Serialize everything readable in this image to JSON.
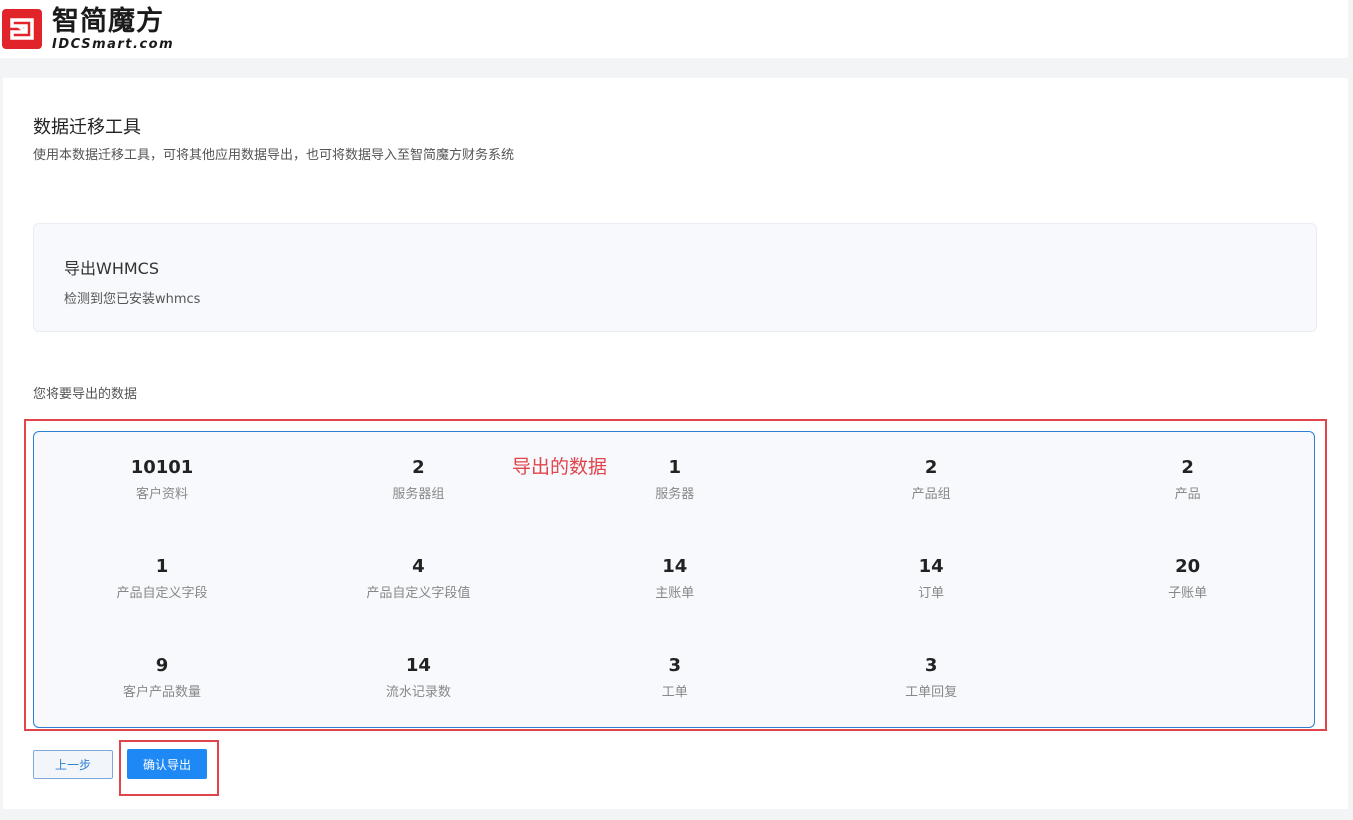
{
  "brand": {
    "name_cn": "智简魔方",
    "name_en": "IDCSmart.com",
    "color": "#e1242a"
  },
  "page": {
    "title": "数据迁移工具",
    "description": "使用本数据迁移工具，可将其他应用数据导出，也可将数据导入至智简魔方财务系统"
  },
  "info": {
    "title": "导出WHMCS",
    "description": "检测到您已安装whmcs"
  },
  "export": {
    "section_label": "您将要导出的数据",
    "annotation": "导出的数据",
    "annotation_color": "#e0454b",
    "stats": [
      {
        "value": "10101",
        "label": "客户资料"
      },
      {
        "value": "2",
        "label": "服务器组"
      },
      {
        "value": "1",
        "label": "服务器"
      },
      {
        "value": "2",
        "label": "产品组"
      },
      {
        "value": "2",
        "label": "产品"
      },
      {
        "value": "1",
        "label": "产品自定义字段"
      },
      {
        "value": "4",
        "label": "产品自定义字段值"
      },
      {
        "value": "14",
        "label": "主账单"
      },
      {
        "value": "14",
        "label": "订单"
      },
      {
        "value": "20",
        "label": "子账单"
      },
      {
        "value": "9",
        "label": "客户产品数量"
      },
      {
        "value": "14",
        "label": "流水记录数"
      },
      {
        "value": "3",
        "label": "工单"
      },
      {
        "value": "3",
        "label": "工单回复"
      }
    ]
  },
  "actions": {
    "prev_label": "上一步",
    "confirm_label": "确认导出",
    "accent_color": "#1e88f5"
  }
}
